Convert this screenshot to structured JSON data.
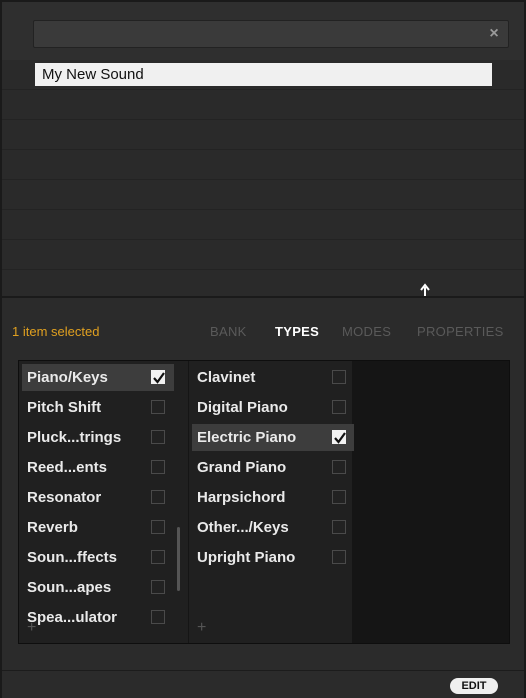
{
  "search": {
    "placeholder": "",
    "value": "",
    "clear_icon": "×"
  },
  "results": {
    "items": [
      "My New Sound"
    ],
    "empty_rows": 7
  },
  "tagbar": {
    "selected_count": "1 item selected",
    "tabs": [
      {
        "label": "BANK",
        "active": false
      },
      {
        "label": "TYPES",
        "active": true
      },
      {
        "label": "MODES",
        "active": false
      },
      {
        "label": "PROPERTIES",
        "active": false
      }
    ]
  },
  "columns": {
    "left": {
      "items": [
        {
          "label": "Piano/Keys",
          "checked": true,
          "highlight": true
        },
        {
          "label": "Pitch Shift",
          "checked": false,
          "highlight": false
        },
        {
          "label": "Pluck...trings",
          "checked": false,
          "highlight": false
        },
        {
          "label": "Reed...ents",
          "checked": false,
          "highlight": false
        },
        {
          "label": "Resonator",
          "checked": false,
          "highlight": false
        },
        {
          "label": "Reverb",
          "checked": false,
          "highlight": false
        },
        {
          "label": "Soun...ffects",
          "checked": false,
          "highlight": false
        },
        {
          "label": "Soun...apes",
          "checked": false,
          "highlight": false
        },
        {
          "label": "Spea...ulator",
          "checked": false,
          "highlight": false
        }
      ],
      "add_label": "+"
    },
    "right": {
      "items": [
        {
          "label": "Clavinet",
          "checked": false,
          "highlight": false
        },
        {
          "label": "Digital Piano",
          "checked": false,
          "highlight": false
        },
        {
          "label": "Electric Piano",
          "checked": true,
          "highlight": true
        },
        {
          "label": "Grand Piano",
          "checked": false,
          "highlight": false
        },
        {
          "label": "Harpsichord",
          "checked": false,
          "highlight": false
        },
        {
          "label": "Other.../Keys",
          "checked": false,
          "highlight": false
        },
        {
          "label": "Upright Piano",
          "checked": false,
          "highlight": false
        }
      ],
      "add_label": "+"
    }
  },
  "footer": {
    "edit_label": "EDIT"
  },
  "colors": {
    "accent": "#e0a020",
    "background": "#2b2b2b",
    "panel": "#202020"
  }
}
